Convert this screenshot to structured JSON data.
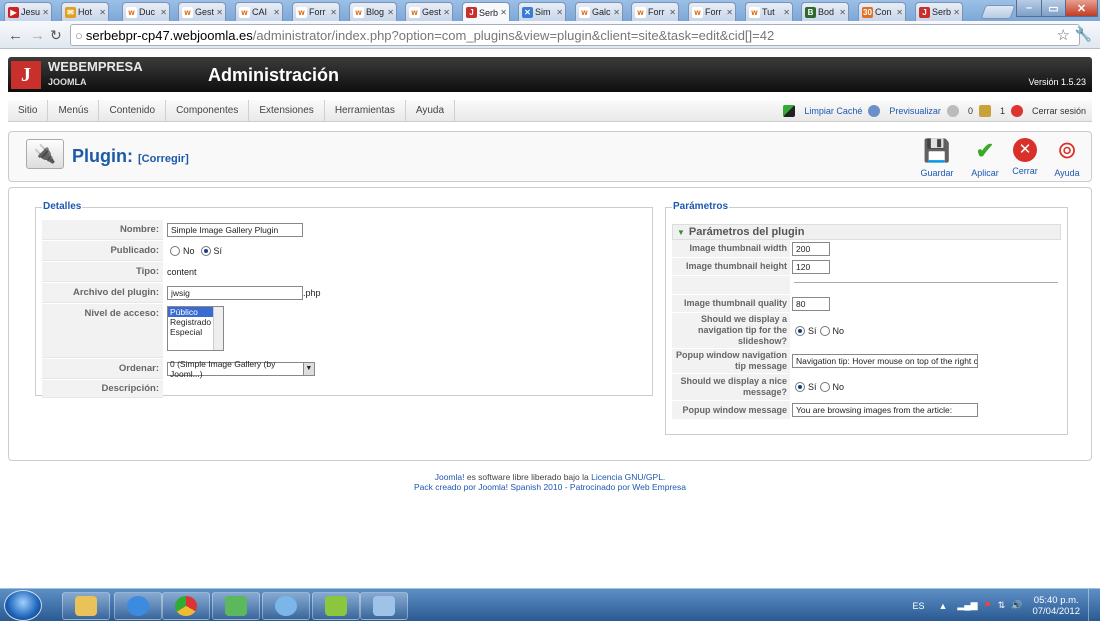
{
  "browser": {
    "tabs": [
      {
        "label": "Jesu",
        "color": "#cc2222",
        "glyph": "▶"
      },
      {
        "label": "Hot",
        "color": "#e0a020",
        "glyph": "✉"
      },
      {
        "label": "Duc",
        "color": "#ffffff",
        "glyph": "w"
      },
      {
        "label": "Gest",
        "color": "#ffffff",
        "glyph": "w"
      },
      {
        "label": "CAI",
        "color": "#ffffff",
        "glyph": "w"
      },
      {
        "label": "Forr",
        "color": "#ffffff",
        "glyph": "w"
      },
      {
        "label": "Blog",
        "color": "#ffffff",
        "glyph": "w"
      },
      {
        "label": "Gest",
        "color": "#ffffff",
        "glyph": "w"
      },
      {
        "label": "Serb",
        "color": "#c9302c",
        "glyph": "J"
      },
      {
        "label": "Sim",
        "color": "#3a7bd5",
        "glyph": "✕"
      },
      {
        "label": "Galc",
        "color": "#ffffff",
        "glyph": "w"
      },
      {
        "label": "Forr",
        "color": "#ffffff",
        "glyph": "w"
      },
      {
        "label": "Forr",
        "color": "#ffffff",
        "glyph": "w"
      },
      {
        "label": "Tut",
        "color": "#ffffff",
        "glyph": "w"
      },
      {
        "label": "Bod",
        "color": "#2d6a2d",
        "glyph": "B"
      },
      {
        "label": "Con",
        "color": "#e07020",
        "glyph": "30"
      },
      {
        "label": "Serb",
        "color": "#c9302c",
        "glyph": "J"
      }
    ],
    "active_tab": 8,
    "url_host": "serbebpr-cp47.webjoomla.es",
    "url_path": "/administrator/index.php?option=com_plugins&view=plugin&client=site&task=edit&cid[]=42"
  },
  "header": {
    "brand": "WEBEMPRESA",
    "brand_sub": "JOOMLA",
    "title": "Administración",
    "version": "Versión 1.5.23"
  },
  "menu": {
    "items": [
      "Sitio",
      "Menús",
      "Contenido",
      "Componentes",
      "Extensiones",
      "Herramientas",
      "Ayuda"
    ],
    "clear_cache": "Limpiar Caché",
    "preview": "Previsualizar",
    "messages_count": "0",
    "users_count": "1",
    "logout": "Cerrar sesión"
  },
  "toolbar": {
    "title": "Plugin:",
    "subtitle": "[Corregir]",
    "save": "Guardar",
    "apply": "Aplicar",
    "close": "Cerrar",
    "help": "Ayuda"
  },
  "details": {
    "legend": "Detalles",
    "name_label": "Nombre:",
    "name_value": "Simple Image Gallery Plugin",
    "published_label": "Publicado:",
    "published_no": "No",
    "published_yes": "Sí",
    "type_label": "Tipo:",
    "type_value": "content",
    "file_label": "Archivo del plugin:",
    "file_value": "jwsig",
    "file_ext": ".php",
    "access_label": "Nivel de acceso:",
    "access_options": [
      "Público",
      "Registrado",
      "Especial"
    ],
    "order_label": "Ordenar:",
    "order_value": "0 (Simple Image Gallery (by Jooml...)",
    "description_label": "Descripción:"
  },
  "params": {
    "legend": "Parámetros",
    "section": "Parámetros del plugin",
    "thumb_width_label": "Image thumbnail width",
    "thumb_width": "200",
    "thumb_height_label": "Image thumbnail height",
    "thumb_height": "120",
    "thumb_quality_label": "Image thumbnail quality",
    "thumb_quality": "80",
    "nav_tip_label": "Should we display a navigation tip for the slideshow?",
    "nav_tip_yes": "Sí",
    "nav_tip_no": "No",
    "popup_tip_label": "Popup window navigation tip message",
    "popup_tip_value": "Navigation tip: Hover mouse on top of the right c",
    "nice_msg_label": "Should we display a nice message?",
    "nice_msg_yes": "Sí",
    "nice_msg_no": "No",
    "popup_msg_label": "Popup window message",
    "popup_msg_value": "You are browsing images from the article:"
  },
  "footer": {
    "line1_a": "Joomla!",
    "line1_b": " es software libre liberado bajo la ",
    "line1_c": "Licencia GNU/GPL.",
    "line2": "Pack creado por Joomla! Spanish 2010 - Patrocinado por Web Empresa"
  },
  "taskbar": {
    "lang": "ES",
    "time": "05:40 p.m.",
    "date": "07/04/2012"
  }
}
